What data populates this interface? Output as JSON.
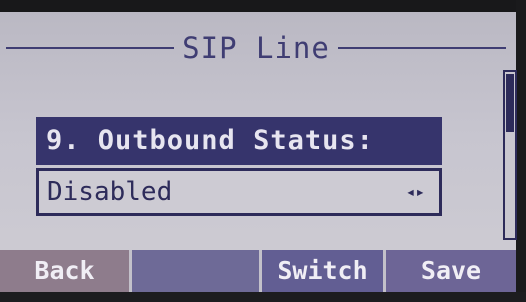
{
  "header": {
    "title": "SIP Line"
  },
  "item": {
    "label": "9. Outbound Status:",
    "value": "Disabled",
    "arrows": "◂▸"
  },
  "softkeys": {
    "back": "Back",
    "empty": "",
    "switch": "Switch",
    "save": "Save"
  }
}
